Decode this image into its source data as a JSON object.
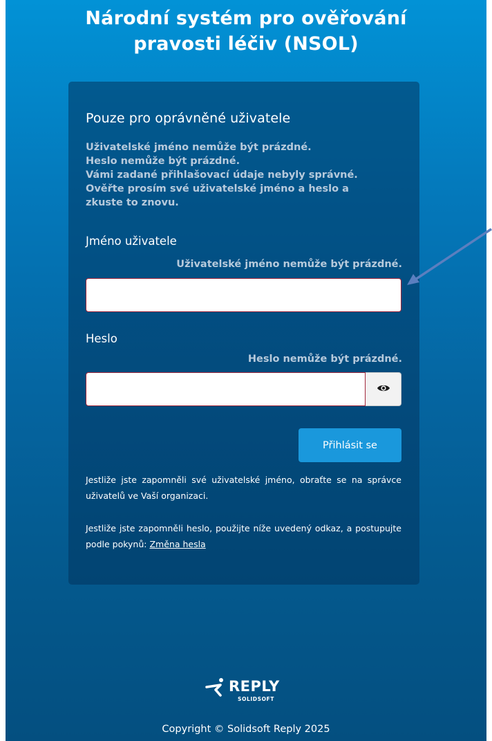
{
  "app": {
    "title_line1": "Národní systém pro ověřování",
    "title_line2": "pravosti léčiv (NSOL)"
  },
  "login": {
    "subtitle": "Pouze pro oprávněné uživatele",
    "errors": [
      "Uživatelské jméno nemůže být prázdné.",
      "Heslo nemůže být prázdné.",
      "Vámi zadané přihlašovací údaje nebyly správné.",
      "Ověřte prosím své uživatelské jméno a heslo a",
      "zkuste to znovu."
    ],
    "username": {
      "label": "Jméno uživatele",
      "error": "Uživatelské jméno nemůže být prázdné.",
      "value": ""
    },
    "password": {
      "label": "Heslo",
      "error": "Heslo nemůže být prázdné.",
      "value": ""
    },
    "submit_label": "Přihlásit se",
    "help_username": "Jestliže jste zapomněli své uživatelské jméno, obraťte se na správce uživatelů ve Vaší organizaci.",
    "help_password_prefix": "Jestliže jste zapomněli heslo, použijte níže uvedený odkaz, a postupujte podle pokynů: ",
    "help_password_link": "Změna hesla"
  },
  "footer": {
    "logo_word": "REPLY",
    "logo_sub": "SOLIDSOFT",
    "copyright": "Copyright © Solidsoft Reply 2025"
  },
  "icons": {
    "eye": "eye-icon",
    "logo_mark": "reply-logo-icon"
  },
  "colors": {
    "background_top": "#0292d6",
    "background_bottom": "#044f80",
    "accent_button": "#1a98dc",
    "error_border": "#a3273b",
    "annotation_arrow": "#5b7fbf"
  }
}
